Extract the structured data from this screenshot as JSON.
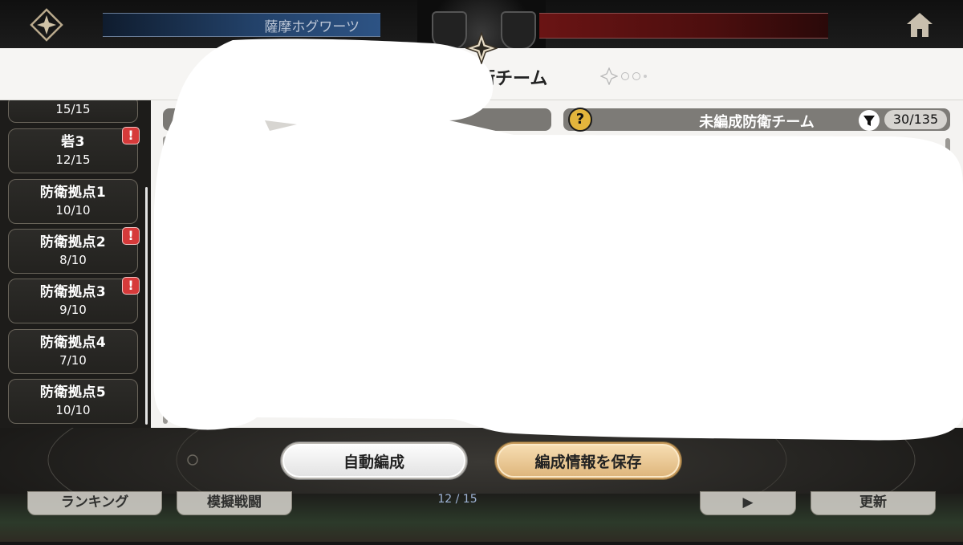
{
  "hud": {
    "home_team": "薩摩ホグワーツ",
    "left_icon": "guild-diamond-icon",
    "right_icon": "home-icon"
  },
  "panel": {
    "title": "衛チーム"
  },
  "sidebar": {
    "items": [
      {
        "name": "",
        "count": "15/15",
        "alert": false
      },
      {
        "name": "砦3",
        "count": "12/15",
        "alert": true
      },
      {
        "name": "防衛拠点1",
        "count": "10/10",
        "alert": false
      },
      {
        "name": "防衛拠点2",
        "count": "8/10",
        "alert": true
      },
      {
        "name": "防衛拠点3",
        "count": "9/10",
        "alert": true
      },
      {
        "name": "防衛拠点4",
        "count": "7/10",
        "alert": false
      },
      {
        "name": "防衛拠点5",
        "count": "10/10",
        "alert": false
      }
    ],
    "alert_mark": "!"
  },
  "unassigned": {
    "help_mark": "?",
    "title": "未編成防衛チーム",
    "count": "30/135"
  },
  "footer": {
    "auto_label": "自動編成",
    "save_label": "編成情報を保存"
  },
  "lower_strip": {
    "ranking_label": "ランキング",
    "mock_battle_label": "模擬戦闘",
    "score": "12 / 15",
    "update_label": "更新"
  },
  "colors": {
    "save_button": "#ddb47a",
    "alert": "#d63a3a",
    "help_icon": "#e3b53c"
  }
}
